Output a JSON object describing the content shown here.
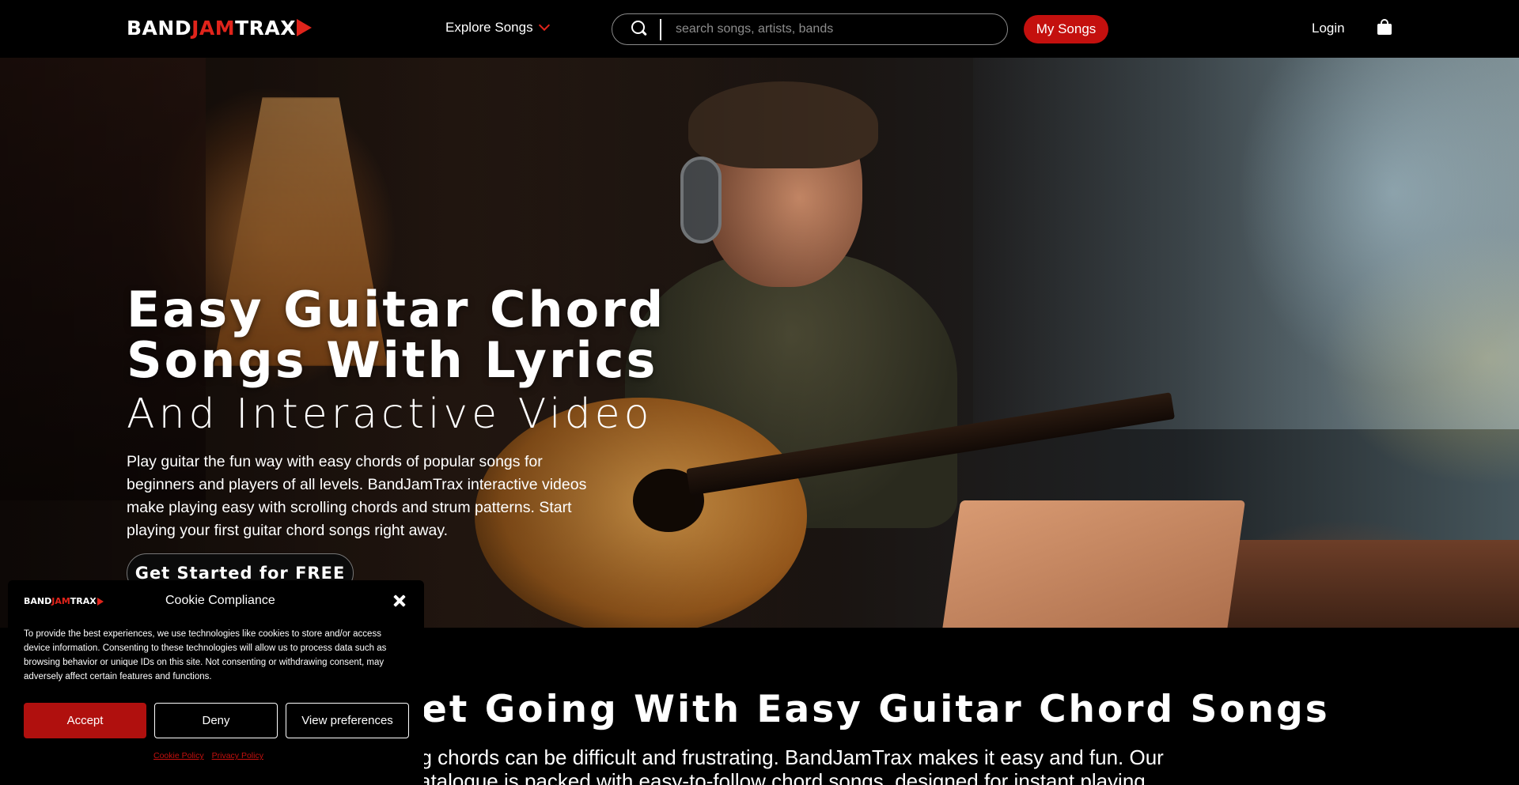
{
  "header": {
    "logo": {
      "part1": "BAND",
      "part2": "JAM",
      "part3": "TRAX"
    },
    "explore_label": "Explore Songs",
    "search_placeholder": "search songs, artists, bands",
    "my_songs_label": "My Songs",
    "login_label": "Login"
  },
  "hero": {
    "title": "Easy Guitar Chord Songs With Lyrics",
    "subtitle": "And Interactive Video",
    "description": "Play guitar the fun way with easy chords of popular songs for beginners and players of all levels. BandJamTrax interactive videos make playing easy with scrolling chords and strum patterns. Start playing your first guitar chord songs right away.",
    "cta_label": "Get Started for FREE"
  },
  "section": {
    "title": "et Going With Easy Guitar Chord Songs",
    "text_line1": "ng chords can be difficult and frustrating. BandJamTrax makes it easy and fun. Our",
    "text_line2": "catalogue is packed with easy-to-follow chord songs, designed for instant playing"
  },
  "cookie": {
    "title": "Cookie Compliance",
    "text": "To provide the best experiences, we use technologies like cookies to store and/or access device information. Consenting to these technologies will allow us to process data such as browsing behavior or unique IDs on this site. Not consenting or withdrawing consent, may adversely affect certain features and functions.",
    "accept_label": "Accept",
    "deny_label": "Deny",
    "preferences_label": "View preferences",
    "cookie_policy_label": "Cookie Policy",
    "privacy_policy_label": "Privacy Policy"
  },
  "colors": {
    "brand_red": "#c4100e",
    "background": "#000000",
    "text": "#ffffff"
  },
  "icons": [
    "search-icon",
    "chevron-down-icon",
    "shopping-bag-icon",
    "close-icon"
  ]
}
